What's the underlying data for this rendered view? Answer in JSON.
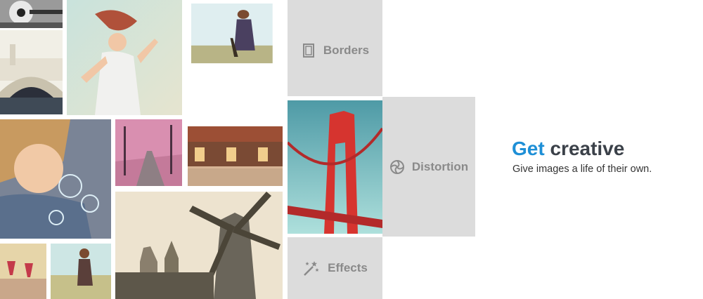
{
  "headline": {
    "part1": "Get",
    "part2": "creative"
  },
  "tagline": "Give images a life of their own.",
  "features": {
    "borders": {
      "label": "Borders",
      "icon": "borders-icon"
    },
    "distortion": {
      "label": "Distortion",
      "icon": "distortion-icon"
    },
    "effects": {
      "label": "Effects",
      "icon": "magic-wand-icon"
    }
  },
  "colors": {
    "accent": "#1e8fd6",
    "headline_dark": "#3b4149",
    "panel_gray": "#dcdcdc",
    "label_gray": "#8a8a8a"
  }
}
